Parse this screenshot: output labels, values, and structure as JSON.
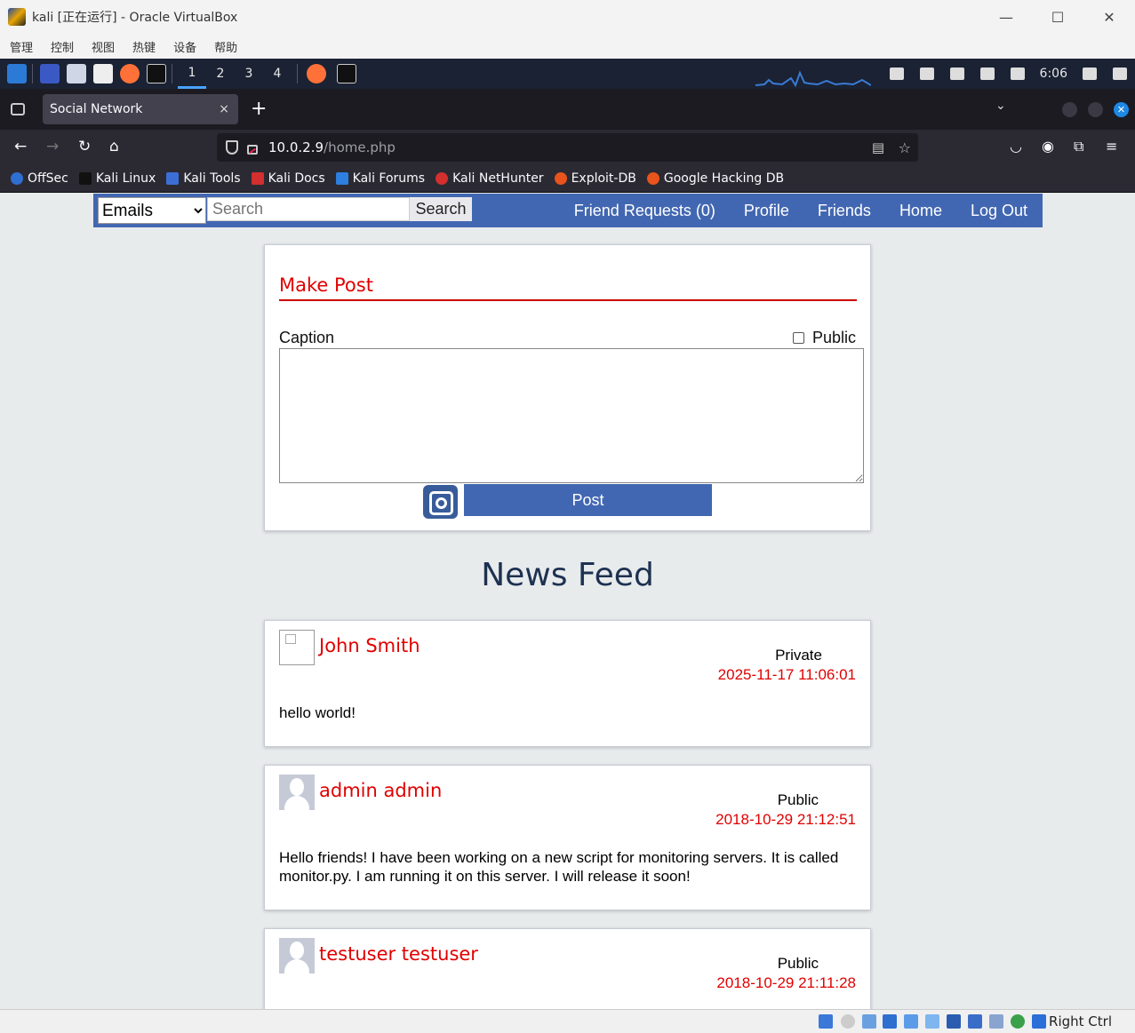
{
  "window": {
    "title": "kali [正在运行] - Oracle VirtualBox",
    "menu": [
      "管理",
      "控制",
      "视图",
      "热键",
      "设备",
      "帮助"
    ]
  },
  "panel": {
    "workspaces": [
      "1",
      "2",
      "3",
      "4"
    ],
    "clock": "6:06"
  },
  "browser": {
    "tab_title": "Social Network",
    "tab_close": "×",
    "new_tab": "+",
    "url_host": "10.0.2.9",
    "url_path": "/home.php",
    "bookmarks": [
      "OffSec",
      "Kali Linux",
      "Kali Tools",
      "Kali Docs",
      "Kali Forums",
      "Kali NetHunter",
      "Exploit-DB",
      "Google Hacking DB"
    ]
  },
  "site": {
    "search_type": "Emails",
    "search_placeholder": "Search",
    "search_button": "Search",
    "nav": [
      "Friend Requests (0)",
      "Profile",
      "Friends",
      "Home",
      "Log Out"
    ],
    "make_post": {
      "title": "Make Post",
      "caption_label": "Caption",
      "public_label": "Public",
      "post_button": "Post"
    },
    "feed_title": "News Feed",
    "posts": [
      {
        "author": "John Smith",
        "visibility": "Private",
        "date": "2025-11-17 11:06:01",
        "body": "hello world!"
      },
      {
        "author": "admin admin",
        "visibility": "Public",
        "date": "2018-10-29 21:12:51",
        "body": "Hello friends! I have been working on a new script for monitoring servers. It is called monitor.py. I am running it on this server. I will release it soon!"
      },
      {
        "author": "testuser testuser",
        "visibility": "Public",
        "date": "2018-10-29 21:11:28",
        "body": ""
      }
    ]
  },
  "status": {
    "host_key": "Right Ctrl"
  },
  "colors": {
    "brand_blue": "#4267b2",
    "accent_red": "#e00000",
    "page_bg": "#e8ebec"
  }
}
